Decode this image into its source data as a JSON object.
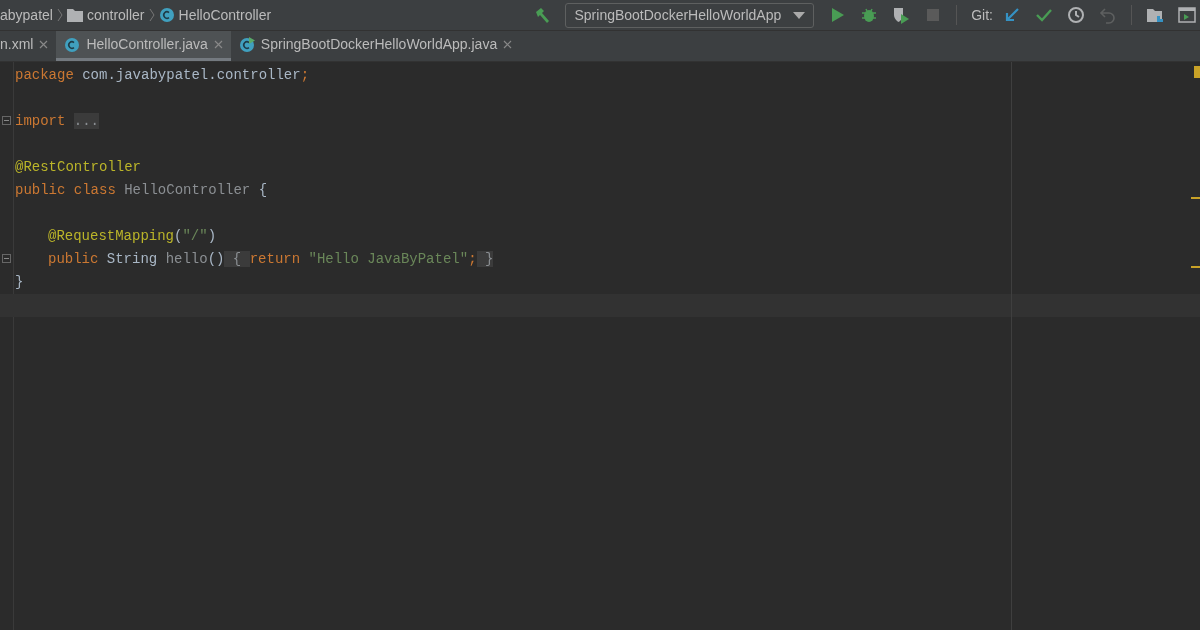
{
  "breadcrumbs": [
    {
      "label": "abypatel",
      "kind": "text"
    },
    {
      "label": "controller",
      "kind": "folder"
    },
    {
      "label": "HelloController",
      "kind": "class"
    }
  ],
  "toolbar": {
    "run_config": "SpringBootDockerHelloWorldApp",
    "git_label": "Git:",
    "buttons": [
      {
        "kind": "build",
        "disabled": false
      },
      {
        "kind": "run",
        "disabled": false
      },
      {
        "kind": "debug",
        "disabled": false
      },
      {
        "kind": "coverage",
        "disabled": false
      },
      {
        "kind": "stop",
        "disabled": true
      }
    ],
    "git_buttons": [
      {
        "kind": "update",
        "disabled": false
      },
      {
        "kind": "commit",
        "disabled": false
      },
      {
        "kind": "history",
        "disabled": false
      },
      {
        "kind": "revert",
        "disabled": true
      }
    ],
    "end_buttons": [
      {
        "kind": "project"
      },
      {
        "kind": "terminal"
      }
    ]
  },
  "tabs": [
    {
      "label": "n.xml",
      "kind": "plain",
      "selected": false
    },
    {
      "label": "HelloController.java",
      "kind": "class",
      "selected": true
    },
    {
      "label": "SpringBootDockerHelloWorldApp.java",
      "kind": "runnable",
      "selected": false
    }
  ],
  "code": [
    {
      "kind": "code",
      "indented": false,
      "tokens": [
        {
          "kind": "keyword",
          "text": "package"
        },
        {
          "kind": "plain",
          "text": " com.javabypatel.controller"
        },
        {
          "kind": "keyword",
          "text": ";"
        }
      ]
    },
    {
      "kind": "blank"
    },
    {
      "kind": "foldable",
      "indented": false,
      "tokens": [
        {
          "kind": "keyword",
          "text": "import "
        },
        {
          "kind": "folded",
          "text": "..."
        }
      ]
    },
    {
      "kind": "blank"
    },
    {
      "kind": "code",
      "indented": false,
      "tokens": [
        {
          "kind": "annotation",
          "text": "@RestController"
        }
      ]
    },
    {
      "kind": "code",
      "indented": false,
      "tokens": [
        {
          "kind": "keyword",
          "text": "public class "
        },
        {
          "kind": "classname",
          "text": "HelloController"
        },
        {
          "kind": "plain",
          "text": " {"
        }
      ]
    },
    {
      "kind": "blank"
    },
    {
      "kind": "code",
      "indented": true,
      "tokens": [
        {
          "kind": "annotation",
          "text": "@RequestMapping"
        },
        {
          "kind": "plain",
          "text": "("
        },
        {
          "kind": "string",
          "text": "\"/\""
        },
        {
          "kind": "plain",
          "text": ")"
        }
      ]
    },
    {
      "kind": "foldable",
      "indented": true,
      "tokens": [
        {
          "kind": "keyword",
          "text": "public "
        },
        {
          "kind": "plain",
          "text": "String "
        },
        {
          "kind": "method",
          "text": "hello"
        },
        {
          "kind": "plain",
          "text": "()"
        },
        {
          "kind": "foldbrace",
          "text": " { "
        },
        {
          "kind": "keyword",
          "text": "return "
        },
        {
          "kind": "string",
          "text": "\"Hello JavaByPatel\""
        },
        {
          "kind": "keyword",
          "text": ";"
        },
        {
          "kind": "foldbrace",
          "text": " }"
        }
      ]
    },
    {
      "kind": "code",
      "indented": false,
      "tokens": [
        {
          "kind": "plain",
          "text": "}"
        }
      ]
    },
    {
      "kind": "caret"
    }
  ]
}
